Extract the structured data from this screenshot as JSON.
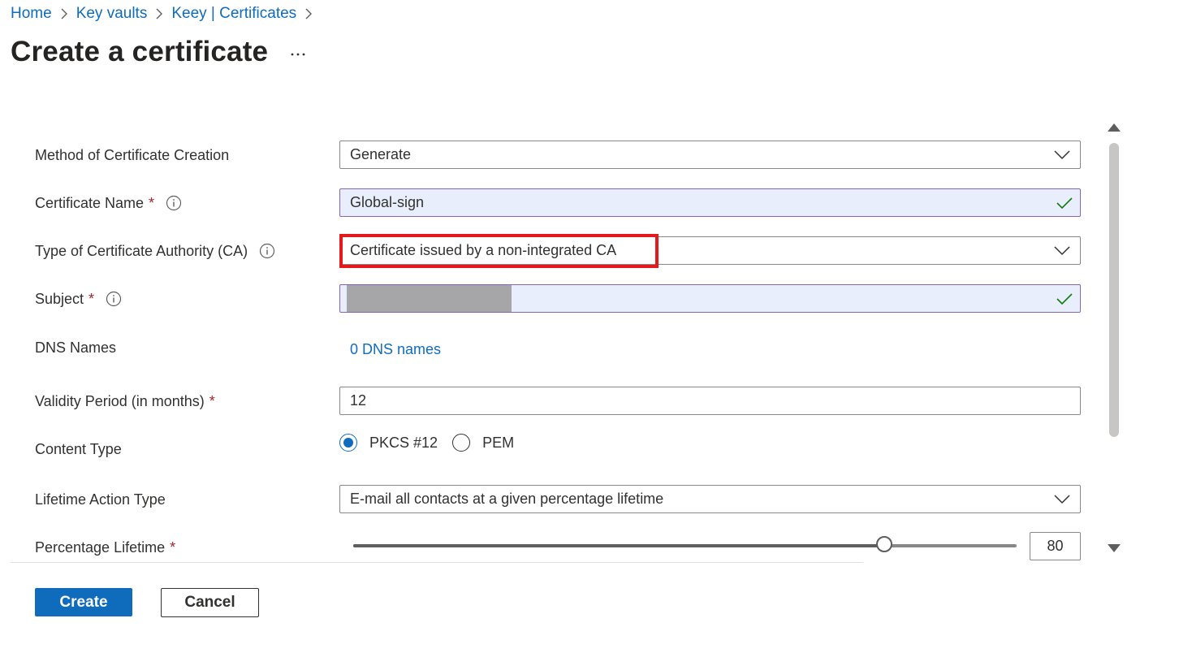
{
  "breadcrumb": [
    "Home",
    "Key vaults",
    "Keey | Certificates"
  ],
  "page": {
    "title": "Create a certificate",
    "more": "..."
  },
  "form": {
    "method": {
      "label": "Method of Certificate Creation",
      "value": "Generate"
    },
    "name": {
      "label": "Certificate Name",
      "required": "*",
      "value": "Global-sign"
    },
    "ca_type": {
      "label": "Type of Certificate Authority (CA)",
      "value": "Certificate issued by a non-integrated CA"
    },
    "subject": {
      "label": "Subject",
      "required": "*",
      "value": ""
    },
    "dns": {
      "label": "DNS Names",
      "link": "0 DNS names"
    },
    "validity": {
      "label": "Validity Period (in months)",
      "required": "*",
      "value": "12"
    },
    "content_type": {
      "label": "Content Type",
      "options": [
        "PKCS #12",
        "PEM"
      ],
      "selected": "PKCS #12"
    },
    "lifetime_action": {
      "label": "Lifetime Action Type",
      "value": "E-mail all contacts at a given percentage lifetime"
    },
    "percentage": {
      "label": "Percentage Lifetime",
      "required": "*",
      "value": "80"
    }
  },
  "actions": {
    "create": "Create",
    "cancel": "Cancel"
  },
  "colors": {
    "accent": "#0f6cbd",
    "valid_border": "#8764b8",
    "valid_bg": "#e8eefc",
    "highlight": "#e3191b",
    "required": "#a4262c",
    "check": "#107c10"
  }
}
